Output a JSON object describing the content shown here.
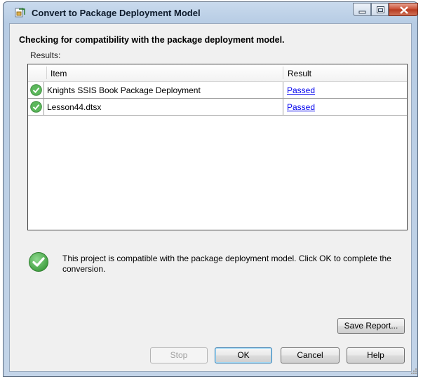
{
  "window": {
    "title": "Convert to Package Deployment Model",
    "app_icon": "package-convert-icon",
    "controls": [
      "minimize-icon",
      "maximize-icon",
      "close-icon"
    ]
  },
  "dialog": {
    "heading": "Checking for compatibility with the package deployment model.",
    "results_label": "Results:",
    "grid": {
      "columns": [
        "Item",
        "Result"
      ],
      "rows": [
        {
          "icon": "check-success-icon",
          "item": "Knights SSIS Book Package Deployment",
          "result": "Passed"
        },
        {
          "icon": "check-success-icon",
          "item": "Lesson44.dtsx",
          "result": "Passed"
        }
      ]
    },
    "status": {
      "icon": "check-success-icon",
      "message": "This project is compatible with the package deployment model. Click OK to complete the conversion."
    }
  },
  "buttons": {
    "save_report": "Save Report...",
    "stop": "Stop",
    "ok": "OK",
    "cancel": "Cancel",
    "help": "Help"
  },
  "colors": {
    "success_green": "#4caf50",
    "link_blue": "#0000ee",
    "close_red": "#c7492e"
  }
}
